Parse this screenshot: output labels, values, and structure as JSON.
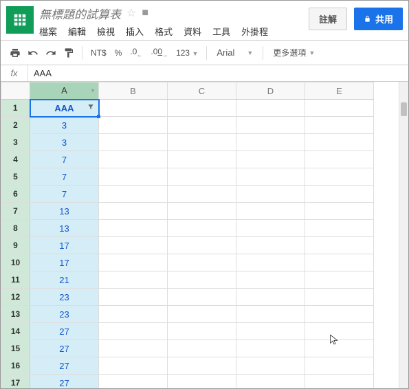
{
  "doc": {
    "title": "無標題的試算表"
  },
  "menus": {
    "file": "檔案",
    "edit": "編輯",
    "view": "檢視",
    "insert": "插入",
    "format": "格式",
    "data": "資料",
    "tools": "工具",
    "addons": "外掛程"
  },
  "buttons": {
    "comment": "註解",
    "share": "共用"
  },
  "toolbar": {
    "currency": "NT$",
    "percent": "%",
    "dec_less": ".0",
    "dec_more": ".00",
    "num_fmt": "123",
    "font": "Arial",
    "more": "更多選項"
  },
  "formula": {
    "fx": "fx",
    "value": "AAA"
  },
  "columns": [
    "A",
    "B",
    "C",
    "D",
    "E"
  ],
  "rows": [
    {
      "n": 1,
      "a": "AAA"
    },
    {
      "n": 2,
      "a": "3"
    },
    {
      "n": 3,
      "a": "3"
    },
    {
      "n": 4,
      "a": "7"
    },
    {
      "n": 5,
      "a": "7"
    },
    {
      "n": 6,
      "a": "7"
    },
    {
      "n": 7,
      "a": "13"
    },
    {
      "n": 8,
      "a": "13"
    },
    {
      "n": 9,
      "a": "17"
    },
    {
      "n": 10,
      "a": "17"
    },
    {
      "n": 11,
      "a": "21"
    },
    {
      "n": 12,
      "a": "23"
    },
    {
      "n": 13,
      "a": "23"
    },
    {
      "n": 14,
      "a": "27"
    },
    {
      "n": 15,
      "a": "27"
    },
    {
      "n": 16,
      "a": "27"
    },
    {
      "n": 17,
      "a": "27"
    }
  ]
}
